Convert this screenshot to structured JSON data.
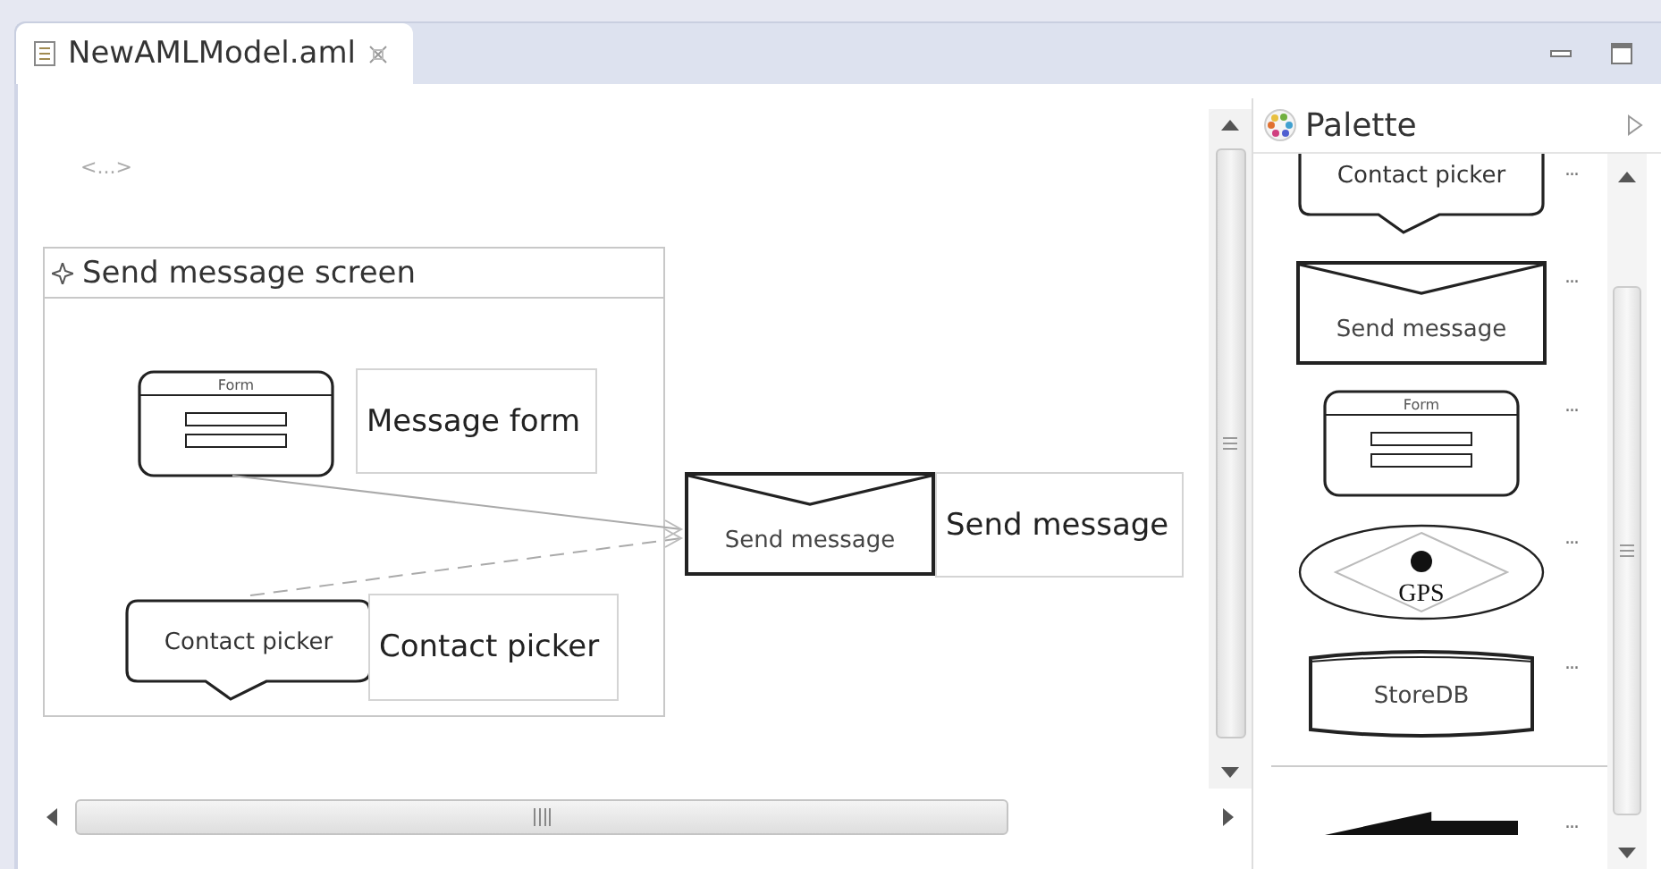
{
  "editor_tab": {
    "title": "NewAMLModel.aml",
    "selected": true
  },
  "canvas": {
    "breadcrumb": "<...>",
    "container": {
      "title": "Send message screen",
      "nodes": [
        {
          "kind": "form",
          "text": "Form",
          "label": "Message form"
        },
        {
          "kind": "contact_picker",
          "text": "Contact picker",
          "label": "Contact picker"
        }
      ]
    },
    "external_nodes": [
      {
        "kind": "send_message",
        "text": "Send message",
        "label": "Send message"
      }
    ],
    "connections": [
      {
        "kind": "solid"
      },
      {
        "kind": "dashed"
      }
    ]
  },
  "palette": {
    "title": "Palette",
    "items": [
      {
        "kind": "contact_picker",
        "text": "Contact picker",
        "more": "..."
      },
      {
        "kind": "send_message",
        "text": "Send message",
        "more": "..."
      },
      {
        "kind": "form",
        "text": "Form",
        "more": "..."
      },
      {
        "kind": "gps",
        "text": "GPS",
        "more": "..."
      },
      {
        "kind": "store_db",
        "text": "StoreDB",
        "more": "..."
      },
      {
        "kind": "wedge",
        "more": "..."
      }
    ]
  }
}
